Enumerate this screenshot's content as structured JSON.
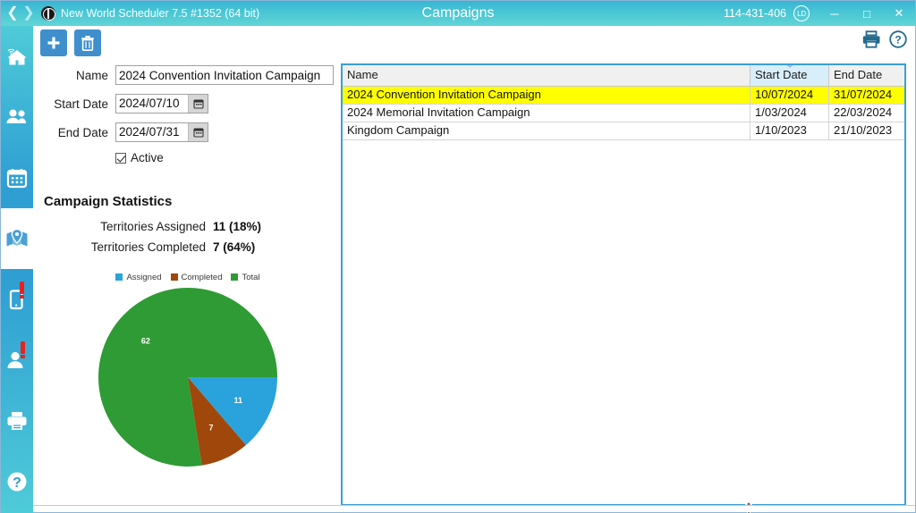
{
  "titlebar": {
    "back_icon": "chevron-left-icon",
    "forward_icon": "chevron-right-icon",
    "app_icon": "globe-icon",
    "app_title": "New World Scheduler 7.5 #1352 (64 bit)",
    "window_title": "Campaigns",
    "license_number": "114-431-406",
    "user_badge": "LD",
    "minimize_label": "─",
    "maximize_label": "□",
    "close_label": "✕",
    "gradient_start": "#39b4d4",
    "gradient_end": "#62d4d6"
  },
  "sidebar": {
    "accent_top": "#4ecbd8",
    "accent_mid": "#2f9fd3",
    "items": [
      {
        "name": "home",
        "icon": "home-wifi-icon",
        "active": false,
        "alert": false
      },
      {
        "name": "publishers",
        "icon": "people-icon",
        "active": false,
        "alert": false
      },
      {
        "name": "schedule",
        "icon": "calendar-icon",
        "active": false,
        "alert": false
      },
      {
        "name": "territories",
        "icon": "map-pin-icon",
        "active": true,
        "alert": false
      },
      {
        "name": "mobile",
        "icon": "mobile-phone-icon",
        "active": false,
        "alert": true
      },
      {
        "name": "contacts",
        "icon": "person-icon",
        "active": false,
        "alert": true
      },
      {
        "name": "print",
        "icon": "printer-icon",
        "active": false,
        "alert": false
      },
      {
        "name": "help",
        "icon": "question-circle-icon",
        "active": false,
        "alert": false
      }
    ]
  },
  "toolbar": {
    "add_icon": "plus-icon",
    "delete_icon": "trash-icon",
    "button_color": "#3e8fcc",
    "print_icon": "printer-icon",
    "help_icon": "question-circle-icon"
  },
  "form": {
    "name_label": "Name",
    "name_value": "2024 Convention Invitation Campaign",
    "name_placeholder": "",
    "start_date_label": "Start Date",
    "start_date_value": "2024/07/10",
    "end_date_label": "End Date",
    "end_date_value": "2024/07/31",
    "active_label": "Active",
    "active_checked": true,
    "calendar_icon": "calendar-icon"
  },
  "stats": {
    "title": "Campaign Statistics",
    "rows": [
      {
        "label": "Territories Assigned",
        "value": "11 (18%)"
      },
      {
        "label": "Territories Completed",
        "value": "7 (64%)"
      }
    ]
  },
  "chart_data": {
    "type": "pie",
    "title": "",
    "legend_position": "top",
    "categories": [
      "Assigned",
      "Completed",
      "Total"
    ],
    "values": [
      11,
      7,
      62
    ],
    "colors": [
      "#2aa3dc",
      "#a0470b",
      "#2e9b34"
    ],
    "labels": [
      "11",
      "7",
      "62"
    ],
    "total": 80,
    "start_angle_deg": 0,
    "direction": "clockwise",
    "legend": [
      {
        "label": "Assigned",
        "color": "#2aa3dc"
      },
      {
        "label": "Completed",
        "color": "#a0470b"
      },
      {
        "label": "Total",
        "color": "#2e9b34"
      }
    ]
  },
  "grid": {
    "columns": [
      {
        "key": "name",
        "label": "Name",
        "sorted": false
      },
      {
        "key": "start_date",
        "label": "Start Date",
        "sorted": true
      },
      {
        "key": "end_date",
        "label": "End Date",
        "sorted": false
      }
    ],
    "selected_row_color": "#ffff00",
    "rows": [
      {
        "name": "2024 Convention Invitation Campaign",
        "start_date": "10/07/2024",
        "end_date": "31/07/2024",
        "selected": true
      },
      {
        "name": "2024 Memorial Invitation Campaign",
        "start_date": "1/03/2024",
        "end_date": "22/03/2024",
        "selected": false
      },
      {
        "name": "Kingdom Campaign",
        "start_date": "1/10/2023",
        "end_date": "21/10/2023",
        "selected": false
      }
    ]
  },
  "cursor": {
    "type": "vertical-resize-cursor"
  }
}
